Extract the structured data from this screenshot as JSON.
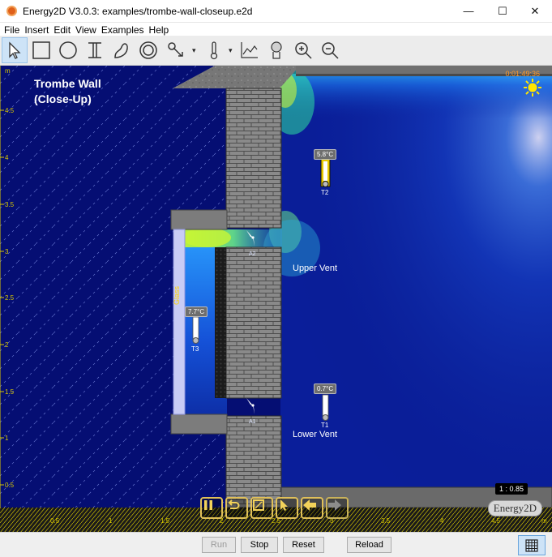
{
  "window": {
    "title": "Energy2D V3.0.3: examples/trombe-wall-closeup.e2d",
    "minimize": "—",
    "maximize": "☐",
    "close": "✕"
  },
  "menu": [
    "File",
    "Insert",
    "Edit",
    "View",
    "Examples",
    "Help"
  ],
  "toolbar": {
    "tools": [
      "select-arrow-icon",
      "rectangle-icon",
      "ellipse-icon",
      "i-beam-icon",
      "blob-icon",
      "annulus-icon",
      "fan-icon",
      "thermometer-icon",
      "graph-icon",
      "heat-flux-icon",
      "zoom-in-icon",
      "zoom-out-icon"
    ],
    "dropdown_arrow": "▾"
  },
  "scene": {
    "title_line1": "Trombe Wall",
    "title_line2": "(Close-Up)",
    "clock": "0:01:49:36",
    "upper_vent": "Upper Vent",
    "lower_vent": "Lower Vent",
    "glass_label": "Glass",
    "scale": "1 : 0.85",
    "logo": "Energy2D",
    "axis_unit": "m",
    "x_ticks": [
      "0.5",
      "1",
      "1.5",
      "2",
      "2.5",
      "3",
      "3.5",
      "4",
      "4.5"
    ],
    "y_ticks": [
      "4.5",
      "4",
      "3.5",
      "3",
      "2.5",
      "2",
      "1.5",
      "1",
      "0.5"
    ],
    "fans": [
      {
        "label": "A2"
      },
      {
        "label": "A1"
      }
    ],
    "thermometers": [
      {
        "label": "T2",
        "reading": "5.8°C"
      },
      {
        "label": "T3",
        "reading": "7.7°C"
      },
      {
        "label": "T1",
        "reading": "0.7°C"
      }
    ],
    "controls": [
      "pause-icon",
      "reset-icon",
      "snapshot-icon",
      "pointer-icon",
      "back-icon",
      "forward-icon"
    ]
  },
  "status": {
    "run": "Run",
    "stop": "Stop",
    "reset": "Reset",
    "reload": "Reload",
    "grid_toggle": "grid-icon"
  },
  "colors": {
    "background_field": "#050e73",
    "hot_field": "#1e8cff",
    "brick": "#8a8a8a",
    "axis": "#d9c800"
  }
}
